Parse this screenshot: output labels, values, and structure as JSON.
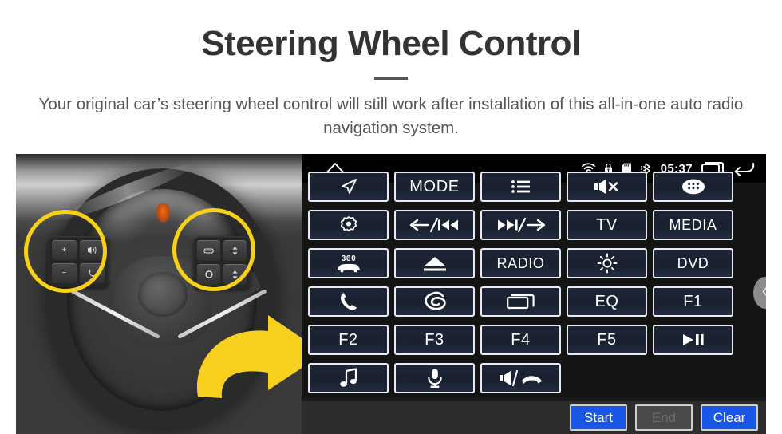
{
  "header": {
    "title": "Steering Wheel Control",
    "subtitle": "Your original car’s steering wheel control will still work after installation of this all-in-one auto radio navigation system."
  },
  "photo": {
    "alt": "steering-wheel-photo",
    "highlight_color": "#f7d117",
    "arrow_color": "#f7cf1f",
    "left_pod_keys": [
      "+",
      "−",
      "voice-icon",
      "phone-icon"
    ],
    "right_pod_keys": [
      "display-icon",
      "up-down-icon",
      "circle-icon",
      "up-down-icon"
    ]
  },
  "unit": {
    "statusbar": {
      "home_icon": "home-icon",
      "wifi_icon": "wifi-icon",
      "lock_icon": "lock-icon",
      "sdcard_icon": "sdcard-icon",
      "bluetooth_icon": "bluetooth-icon",
      "clock": "05:37",
      "recents_icon": "recents-icon",
      "back_icon": "back-icon"
    },
    "accent_color": "#1a56e8",
    "button_rows": [
      [
        {
          "icon": "navigation-icon",
          "label": ""
        },
        {
          "icon": "",
          "label": "MODE"
        },
        {
          "icon": "list-icon",
          "label": ""
        },
        {
          "icon": "mute-icon",
          "label": ""
        },
        {
          "icon": "apps-icon",
          "label": ""
        }
      ],
      [
        {
          "icon": "camera-icon",
          "label": ""
        },
        {
          "icon": "prev-track-icon",
          "label": ""
        },
        {
          "icon": "next-track-icon",
          "label": ""
        },
        {
          "icon": "",
          "label": "TV"
        },
        {
          "icon": "",
          "label": "MEDIA"
        }
      ],
      [
        {
          "icon": "360-car-icon",
          "label": ""
        },
        {
          "icon": "eject-icon",
          "label": ""
        },
        {
          "icon": "",
          "label": "RADIO"
        },
        {
          "icon": "brightness-icon",
          "label": ""
        },
        {
          "icon": "",
          "label": "DVD"
        }
      ],
      [
        {
          "icon": "phone-icon",
          "label": ""
        },
        {
          "icon": "voice-swirl-icon",
          "label": ""
        },
        {
          "icon": "recents-icon",
          "label": ""
        },
        {
          "icon": "",
          "label": "EQ"
        },
        {
          "icon": "",
          "label": "F1"
        }
      ],
      [
        {
          "icon": "",
          "label": "F2"
        },
        {
          "icon": "",
          "label": "F3"
        },
        {
          "icon": "",
          "label": "F4"
        },
        {
          "icon": "",
          "label": "F5"
        },
        {
          "icon": "play-pause-icon",
          "label": ""
        }
      ],
      [
        {
          "icon": "music-note-icon",
          "label": ""
        },
        {
          "icon": "microphone-icon",
          "label": ""
        },
        {
          "icon": "speaker-hangup-icon",
          "label": ""
        }
      ]
    ],
    "footer": {
      "start_label": "Start",
      "end_label": "End",
      "clear_label": "Clear"
    },
    "side_tab_icon": "chevron-left-icon"
  }
}
